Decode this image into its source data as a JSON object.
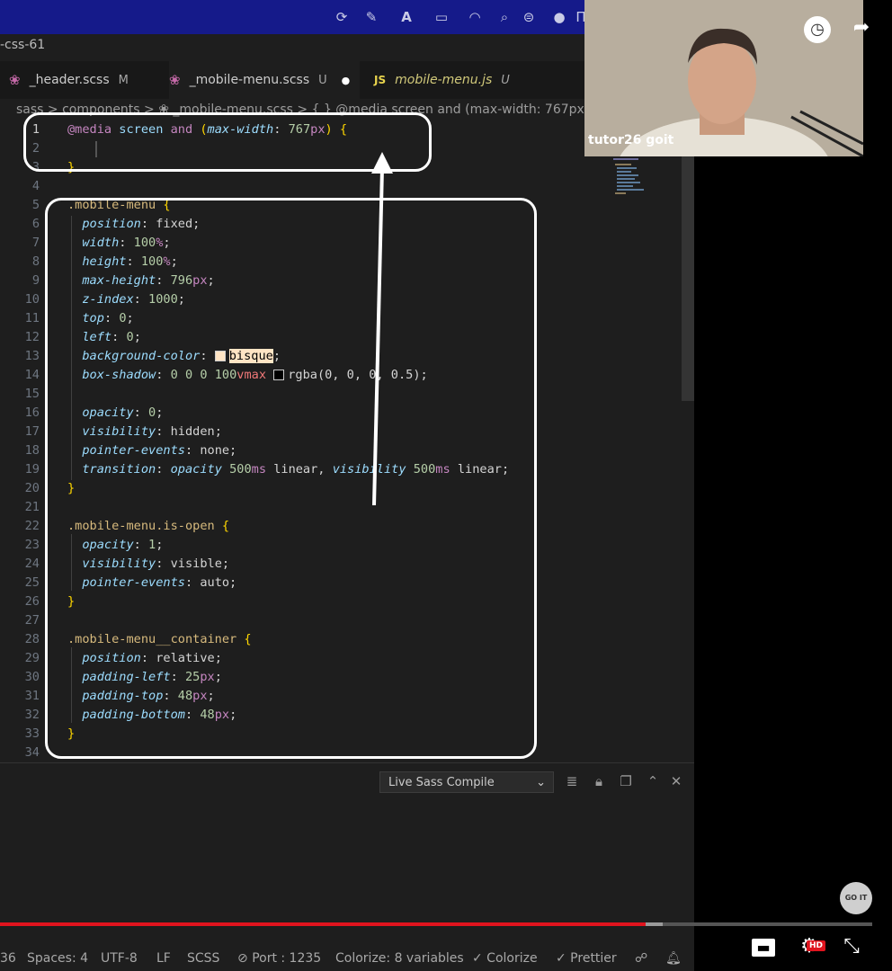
{
  "project_title": "-css-61",
  "tabs": [
    {
      "label": "_header.scss",
      "status": "M",
      "icon": "sass-icon"
    },
    {
      "label": "_mobile-menu.scss",
      "status": "U",
      "icon": "sass-icon",
      "dirty": true
    },
    {
      "label": "mobile-menu.js",
      "status": "U",
      "icon": "js-icon",
      "icon_text": "JS"
    }
  ],
  "breadcrumb": "sass  >  components  >  ❀  _mobile-menu.scss  >  { } @media screen and (max-width: 767px)",
  "line_numbers": [
    "1",
    "2",
    "3",
    "4",
    "5",
    "6",
    "7",
    "8",
    "9",
    "10",
    "11",
    "12",
    "13",
    "14",
    "15",
    "16",
    "17",
    "18",
    "19",
    "20",
    "21",
    "22",
    "23",
    "24",
    "25",
    "26",
    "27",
    "28",
    "29",
    "30",
    "31",
    "32",
    "33",
    "34"
  ],
  "code": {
    "l1": {
      "at": "@media",
      "screen": "screen",
      "and": "and",
      "paren_open": "(",
      "prop": "max-width",
      "colon": ": ",
      "num": "767",
      "unit": "px",
      "paren_close": ")",
      "brace": " {"
    },
    "l3": "}",
    "l5": {
      "sel": ".mobile-menu",
      "brace": " {"
    },
    "l6": {
      "prop": "position",
      "val": ": fixed;"
    },
    "l7": {
      "prop": "width",
      "num": "100",
      "unit": "%",
      "end": ";"
    },
    "l8": {
      "prop": "height",
      "num": "100",
      "unit": "%",
      "end": ";"
    },
    "l9": {
      "prop": "max-height",
      "num": "796",
      "unit": "px",
      "end": ";"
    },
    "l10": {
      "prop": "z-index",
      "num": "1000",
      "end": ";"
    },
    "l11": {
      "prop": "top",
      "num": "0",
      "end": ";"
    },
    "l12": {
      "prop": "left",
      "num": "0",
      "end": ";"
    },
    "l13": {
      "prop": "background-color",
      "val": "bisque",
      "end": ";"
    },
    "l14": {
      "prop": "box-shadow",
      "nums": "0 0 0 100",
      "unit": "vmax",
      "val": "rgba(0, 0, 0, 0.5);"
    },
    "l16": {
      "prop": "opacity",
      "num": "0",
      "end": ";"
    },
    "l17": {
      "prop": "visibility",
      "val": ": hidden;"
    },
    "l18": {
      "prop": "pointer-events",
      "val": ": none;"
    },
    "l19": {
      "prop": "transition",
      "prop2": "opacity",
      "num1": "500",
      "unit1": "ms",
      "mid": " linear, ",
      "prop3": "visibility",
      "num2": "500",
      "unit2": "ms",
      "tail": " linear;"
    },
    "l20": "}",
    "l22": {
      "sel": ".mobile-menu.is-open",
      "brace": " {"
    },
    "l23": {
      "prop": "opacity",
      "num": "1",
      "end": ";"
    },
    "l24": {
      "prop": "visibility",
      "val": ": visible;"
    },
    "l25": {
      "prop": "pointer-events",
      "val": ": auto;"
    },
    "l26": "}",
    "l28": {
      "sel": ".mobile-menu__container",
      "brace": " {"
    },
    "l29": {
      "prop": "position",
      "val": ": relative;"
    },
    "l30": {
      "prop": "padding-left",
      "num": "25",
      "unit": "px",
      "end": ";"
    },
    "l31": {
      "prop": "padding-top",
      "num": "48",
      "unit": "px",
      "end": ";"
    },
    "l32": {
      "prop": "padding-bottom",
      "num": "48",
      "unit": "px",
      "end": ";"
    },
    "l33": "}"
  },
  "panel": {
    "select_value": "Live Sass Compile"
  },
  "statusbar": {
    "col": "36",
    "spaces": "Spaces: 4",
    "encoding": "UTF-8",
    "eol": "LF",
    "language": "SCSS",
    "port": "Port : 1235",
    "colorize_vars": "Colorize: 8 variables",
    "colorize": "✓ Colorize",
    "prettier": "✓ Prettier"
  },
  "video": {
    "presenter": "tutor26 goit",
    "progress": 0.74,
    "buffered": 0.76,
    "quality_badge": "HD",
    "channel_badge": "GO IT"
  },
  "colors": {
    "accent": "#e0141e",
    "annotation": "#ffffff",
    "menubar": "#151a8a"
  }
}
